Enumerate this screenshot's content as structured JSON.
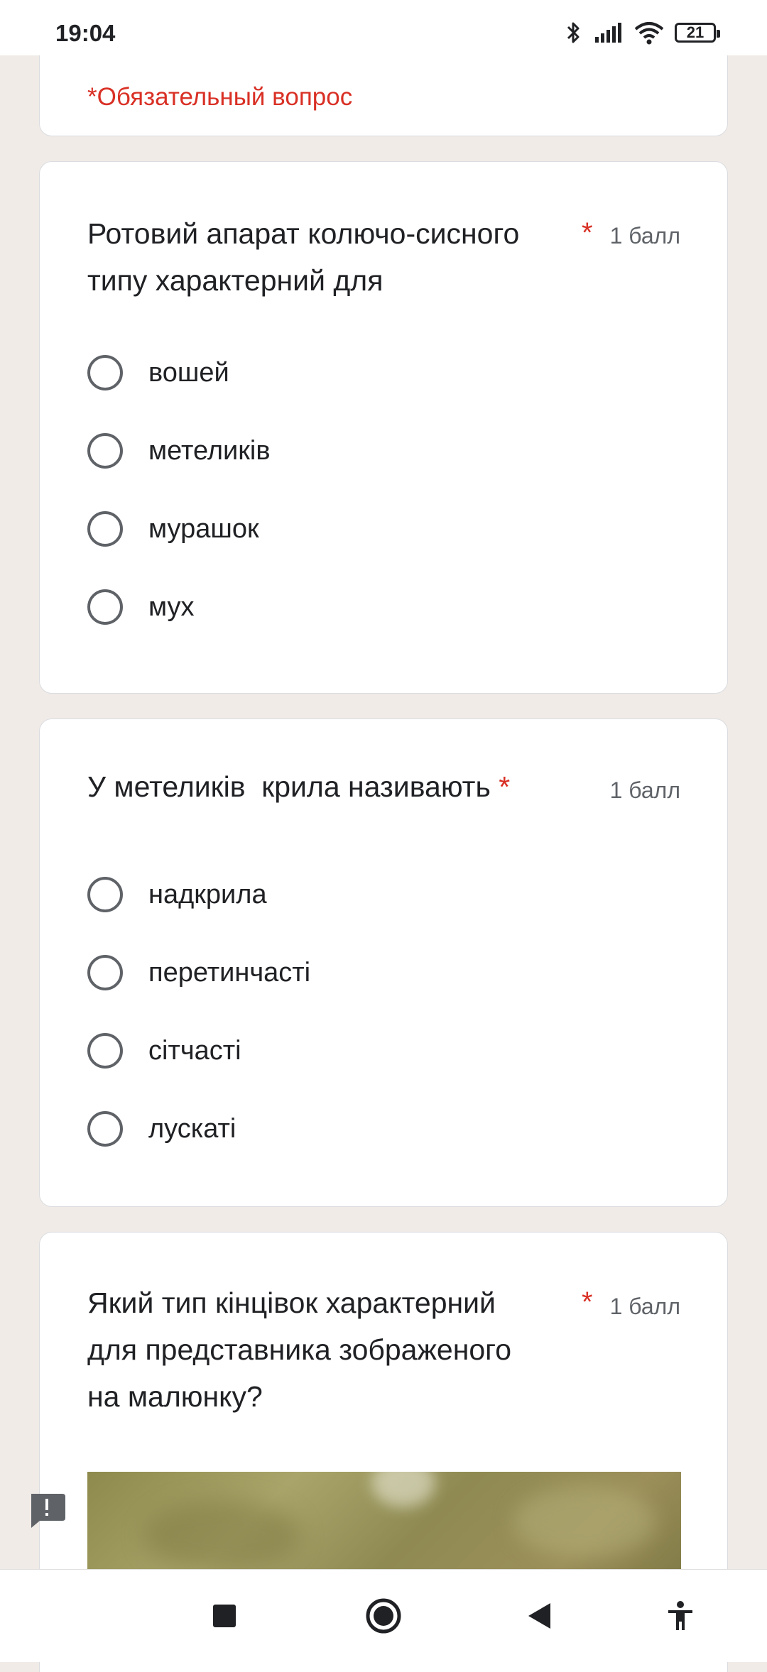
{
  "status": {
    "time": "19:04",
    "battery": "21"
  },
  "form": {
    "required_note": "*Обязательный вопрос",
    "questions": [
      {
        "title_lines": [
          "Ротовий апарат колючо-сисного",
          "типу характерний для"
        ],
        "required_mark": "*",
        "points": "1 балл",
        "options": [
          "вошей",
          "метеликів",
          "мурашок",
          "мух"
        ]
      },
      {
        "title_lines": [
          "У метеликів  крила називають"
        ],
        "required_mark": "*",
        "points": "1 балл",
        "options": [
          "надкрила",
          "перетинчасті",
          "сітчасті",
          "лускаті"
        ]
      },
      {
        "title_lines": [
          "Який тип кінцівок характерний",
          "для представника зображеного",
          "на малюнку?"
        ],
        "required_mark": "*",
        "points": "1 балл"
      }
    ]
  },
  "icons": {
    "bluetooth": "bluetooth-icon",
    "signal": "signal-icon",
    "wifi": "wifi-icon",
    "feedback": "feedback-icon",
    "nav_recents": "square-icon",
    "nav_home": "home-circle-icon",
    "nav_back": "back-triangle-icon",
    "accessibility": "accessibility-icon"
  },
  "colors": {
    "required": "#d93025",
    "background": "#f0ebe7",
    "radio": "#5f6368"
  }
}
